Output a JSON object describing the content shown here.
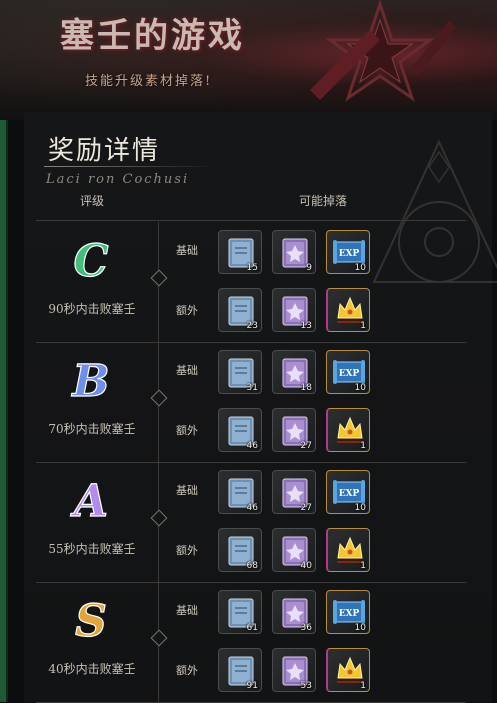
{
  "banner": {
    "title": "塞壬的游戏",
    "subtitle": "技能升级素材掉落!"
  },
  "panel": {
    "title": "奖励详情",
    "subtitle": "Laci ron Cochusi",
    "col_grade": "评级",
    "col_drops": "可能掉落"
  },
  "labels": {
    "basic": "基础",
    "extra": "额外"
  },
  "tiers": [
    {
      "grade": "C",
      "condition": "90秒内击败塞壬",
      "color": "#3fbf7a",
      "basic": {
        "blue_book": "15",
        "purple_book": "9",
        "exp_scroll": "10"
      },
      "extra": {
        "blue_book": "23",
        "purple_book": "13",
        "crown": "1"
      }
    },
    {
      "grade": "B",
      "condition": "70秒内击败塞壬",
      "color": "#6f8ff0",
      "basic": {
        "blue_book": "31",
        "purple_book": "18",
        "exp_scroll": "10"
      },
      "extra": {
        "blue_book": "46",
        "purple_book": "27",
        "crown": "1"
      }
    },
    {
      "grade": "A",
      "condition": "55秒内击败塞壬",
      "color": "#b28af0",
      "basic": {
        "blue_book": "46",
        "purple_book": "27",
        "exp_scroll": "10"
      },
      "extra": {
        "blue_book": "68",
        "purple_book": "40",
        "crown": "1"
      }
    },
    {
      "grade": "S",
      "condition": "40秒内击败塞壬",
      "color": "#e3a53a",
      "basic": {
        "blue_book": "61",
        "purple_book": "36",
        "exp_scroll": "10"
      },
      "extra": {
        "blue_book": "91",
        "purple_book": "53",
        "crown": "1"
      }
    }
  ],
  "icons": {
    "blue_book": "blue-skill-book-icon",
    "purple_book": "purple-skill-book-icon",
    "exp_scroll": "exp-scroll-icon",
    "crown": "gold-crown-icon"
  },
  "exp_text": "EXP"
}
